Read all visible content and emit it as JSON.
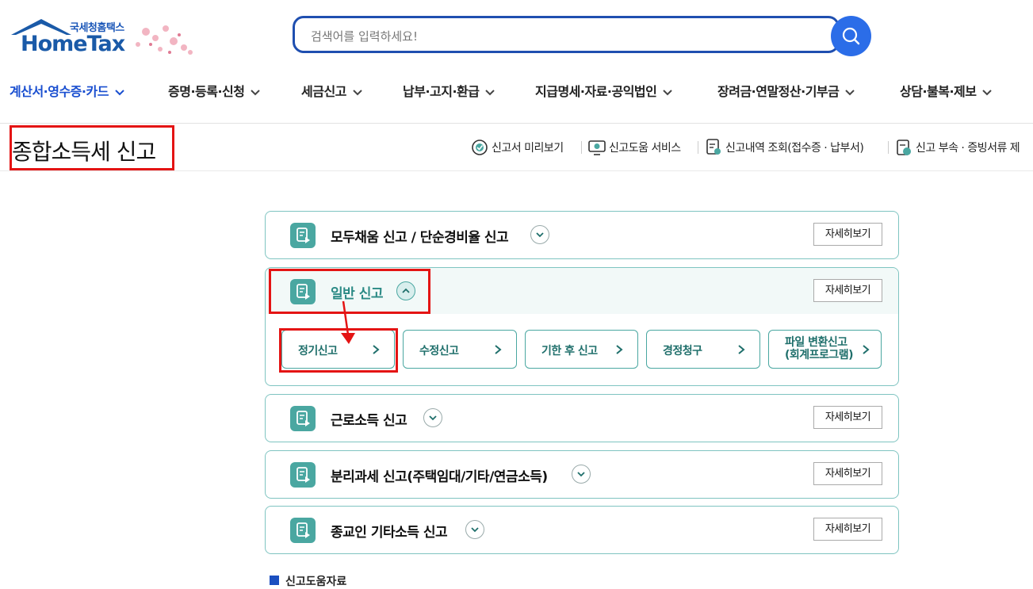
{
  "logo": {
    "small_text": "국세청홈택스",
    "big_text": "HomeTax"
  },
  "search": {
    "placeholder": "검색어를 입력하세요!"
  },
  "nav": [
    {
      "label": "계산서·영수증·카드"
    },
    {
      "label": "증명·등록·신청"
    },
    {
      "label": "세금신고"
    },
    {
      "label": "납부·고지·환급"
    },
    {
      "label": "지급명세·자료·공익법인"
    },
    {
      "label": "장려금·연말정산·기부금"
    },
    {
      "label": "상담·불복·제보"
    }
  ],
  "page_title": "종합소득세 신고",
  "utilities": [
    {
      "label": "신고서 미리보기"
    },
    {
      "label": "신고도움 서비스"
    },
    {
      "label": "신고내역 조회(접수증 · 납부서)"
    },
    {
      "label": "신고 부속 · 증빙서류 제"
    }
  ],
  "sections": [
    {
      "title": "모두채움 신고 / 단순경비율 신고",
      "detail": "자세히보기"
    },
    {
      "title": "일반 신고",
      "detail": "자세히보기",
      "sub_items": [
        {
          "label": "정기신고"
        },
        {
          "label": "수정신고"
        },
        {
          "label": "기한 후 신고"
        },
        {
          "label": "경정청구"
        },
        {
          "label_line1": "파일 변환신고",
          "label_line2": "(회계프로그램)"
        }
      ]
    },
    {
      "title": "근로소득 신고",
      "detail": "자세히보기"
    },
    {
      "title": "분리과세 신고(주택임대/기타/연금소득)",
      "detail": "자세히보기"
    },
    {
      "title": "종교인 기타소득 신고",
      "detail": "자세히보기"
    }
  ],
  "legend_label": "신고도움자료",
  "colors": {
    "accent": "#1a4fd0",
    "teal": "#4aa7a1",
    "highlight": "#e41414"
  }
}
